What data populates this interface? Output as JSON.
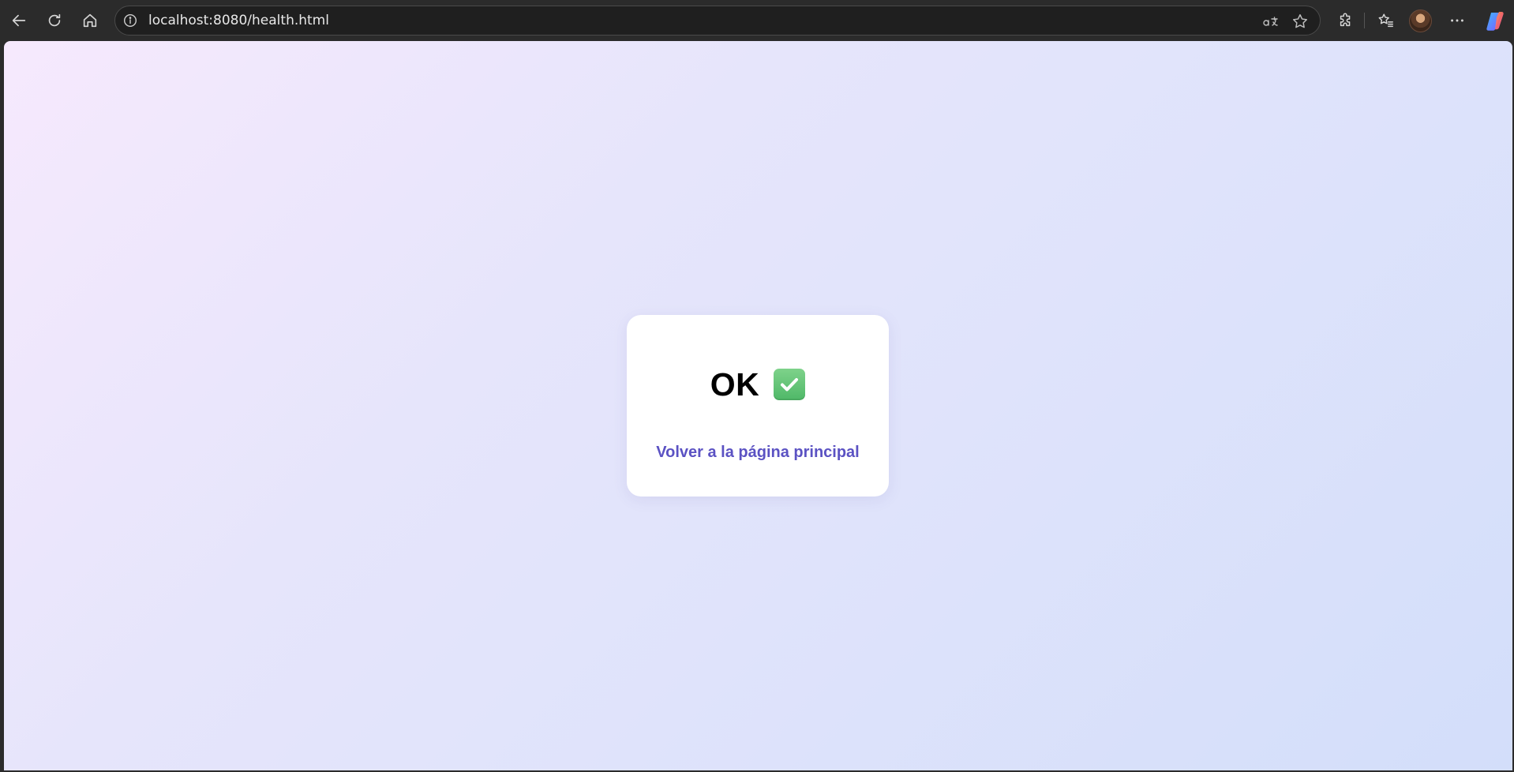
{
  "browser": {
    "url": "localhost:8080/health.html",
    "icons": {
      "back": "back-arrow-icon",
      "reload": "reload-icon",
      "home": "home-icon",
      "site_info": "info-icon",
      "read_aloud": "read-aloud-icon",
      "favorite": "star-icon",
      "extensions": "puzzle-icon",
      "favorites": "favorites-icon",
      "profile": "avatar",
      "more": "more-icon",
      "copilot": "copilot-icon"
    }
  },
  "page": {
    "status": "OK",
    "status_icon": "check-mark-button-icon",
    "link_text": "Volver a la página principal",
    "colors": {
      "link": "#5b52c3",
      "check": "#5cbf6e",
      "bg_start": "#f6e9fd",
      "bg_end": "#d3defa"
    }
  }
}
